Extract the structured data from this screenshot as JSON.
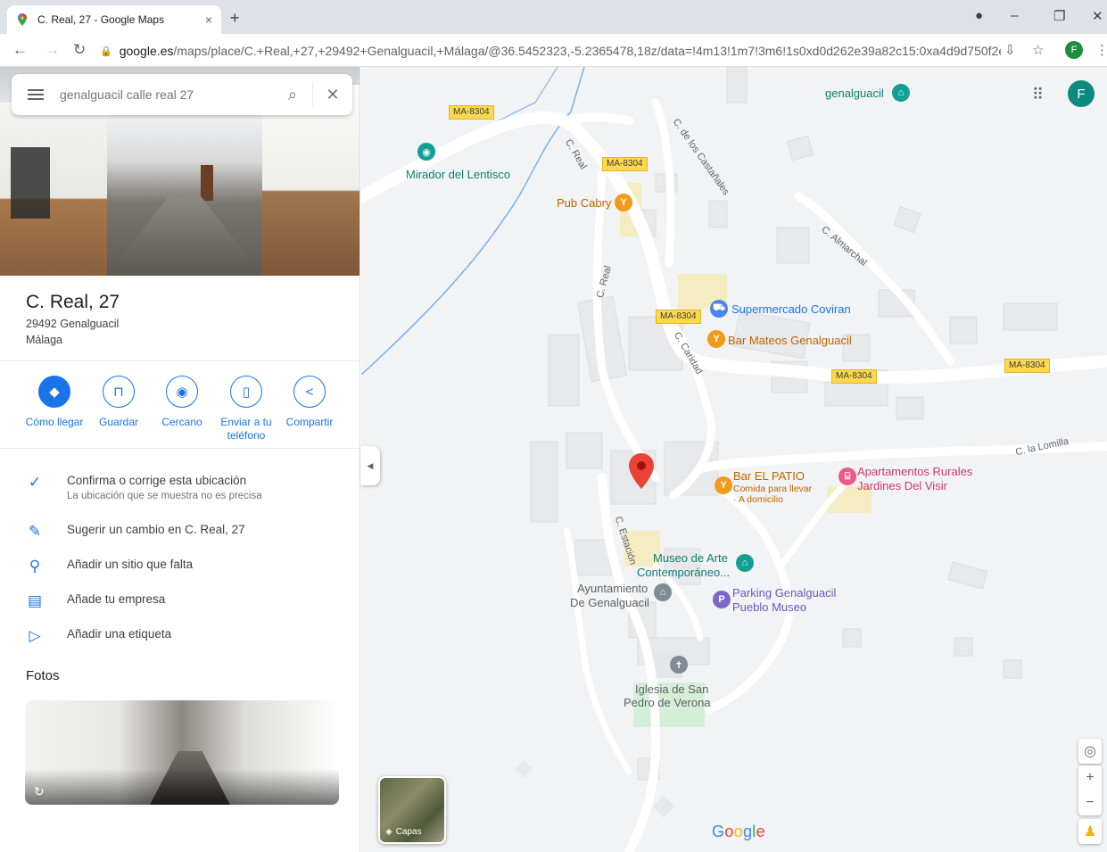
{
  "browser": {
    "tab_title": "C. Real, 27 - Google Maps",
    "tab_close": "×",
    "new_tab": "+",
    "url_host": "google.es",
    "url_path": "/maps/place/C.+Real,+27,+29492+Genalguacil,+Málaga/@36.5452323,-5.2365478,18z/data=!4m13!1m7!3m6!1s0xd0d262e39a82c15:0xa4d9d750f2e...",
    "profile_initial": "F",
    "window_controls": [
      "–",
      "❐",
      "✕"
    ]
  },
  "search": {
    "placeholder": "genalguacil calle real 27"
  },
  "place": {
    "title": "C. Real, 27",
    "address_line1": "29492 Genalguacil",
    "address_line2": "Málaga"
  },
  "actions": [
    {
      "label": "Cómo llegar",
      "icon": "directions-icon"
    },
    {
      "label": "Guardar",
      "icon": "bookmark-icon"
    },
    {
      "label": "Cercano",
      "icon": "nearby-icon"
    },
    {
      "label": "Enviar a tu teléfono",
      "icon": "send-to-phone-icon"
    },
    {
      "label": "Compartir",
      "icon": "share-icon"
    }
  ],
  "list": [
    {
      "text": "Confirma o corrige esta ubicación",
      "sub": "La ubicación que se muestra no es precisa",
      "icon": "confirm-location-icon"
    },
    {
      "text": "Sugerir un cambio en C. Real, 27",
      "icon": "pencil-icon"
    },
    {
      "text": "Añadir un sitio que falta",
      "icon": "add-place-icon"
    },
    {
      "text": "Añade tu empresa",
      "icon": "add-business-icon"
    },
    {
      "text": "Añadir una etiqueta",
      "icon": "label-icon"
    }
  ],
  "photos_heading": "Fotos",
  "map": {
    "road_tags": [
      "MA-8304",
      "MA-8304",
      "MA-8304",
      "MA-8304",
      "MA-8304"
    ],
    "streets": [
      "C. de los Castañales",
      "C. Real",
      "C. Real",
      "C. Almarchal",
      "C. Caridad",
      "C. la Lomilla",
      "C. Estación"
    ],
    "places": {
      "genalguacil": "genalguacil",
      "mirador": "Mirador del Lentisco",
      "pub_cabry": "Pub Cabry",
      "supermercado": "Supermercado Coviran",
      "bar_mateos": "Bar Mateos Genalguacil",
      "bar_patio": "Bar EL PATIO",
      "bar_patio_sub1": "Comida para llevar",
      "bar_patio_sub2": "· A domicilio",
      "apartamentos1": "Apartamentos Rurales",
      "apartamentos2": "Jardines Del Visir",
      "museo1": "Museo de Arte",
      "museo2": "Contemporáneo...",
      "ayuntamiento1": "Ayuntamiento",
      "ayuntamiento2": "De Genalguacil",
      "parking1": "Parking Genalguacil",
      "parking2": "Pueblo Museo",
      "iglesia1": "Iglesia de San",
      "iglesia2": "Pedro de Verona"
    },
    "layers_label": "Capas",
    "logo": "Google",
    "avatar_initial": "F"
  }
}
